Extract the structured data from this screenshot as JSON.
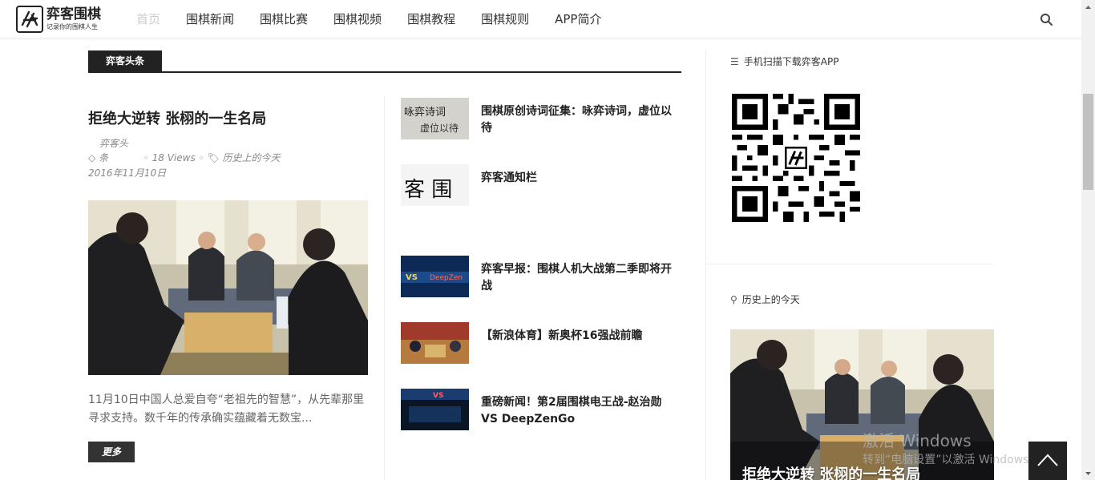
{
  "header": {
    "logo_title": "弈客围棋",
    "logo_subtitle": "记录你的围棋人生",
    "nav": [
      {
        "label": "首页",
        "active": true
      },
      {
        "label": "围棋新闻"
      },
      {
        "label": "围棋比赛"
      },
      {
        "label": "围棋视频"
      },
      {
        "label": "围棋教程"
      },
      {
        "label": "围棋规则"
      },
      {
        "label": "APP简介"
      }
    ]
  },
  "section": {
    "label": "弈客头条"
  },
  "feature": {
    "title": "拒绝大逆转 张栩的一生名局",
    "meta_author_line1": "弈客头",
    "meta_author_line2": "条",
    "views": "18 Views",
    "category": "历史上的今天",
    "date": "2016年11月10日",
    "excerpt": "11月10日中国人总爱自夸“老祖先的智慧”，从先辈那里寻求支持。数千年的传承确实蕴藏着无数宝...",
    "more": "更多"
  },
  "list": [
    {
      "title": "围棋原创诗词征集：咏弈诗词，虚位以待",
      "thumb": "calligraphy"
    },
    {
      "title": "弈客通知栏",
      "thumb": "logo"
    },
    {
      "title": "弈客早报：围棋人机大战第二季即将开战",
      "thumb": "banner-blue"
    },
    {
      "title": "【新浪体育】新奥杯16强战前瞻",
      "thumb": "match-photo"
    },
    {
      "title": "重磅新闻！第2届围棋电王战-赵治勋 VS DeepZenGo",
      "thumb": "banner-dark"
    }
  ],
  "sidebar": {
    "app_widget_title": "手机扫描下载弈客APP",
    "history_widget_title": "历史上的今天",
    "history_caption": "拒绝大逆转 张栩的一生名局"
  },
  "watermark": {
    "line1": "激活 Windows",
    "line2": "转到“电脑设置”以激活 Windows。"
  },
  "colors": {
    "accent": "#222222",
    "muted": "#888888",
    "nav_active": "#cccccc"
  }
}
